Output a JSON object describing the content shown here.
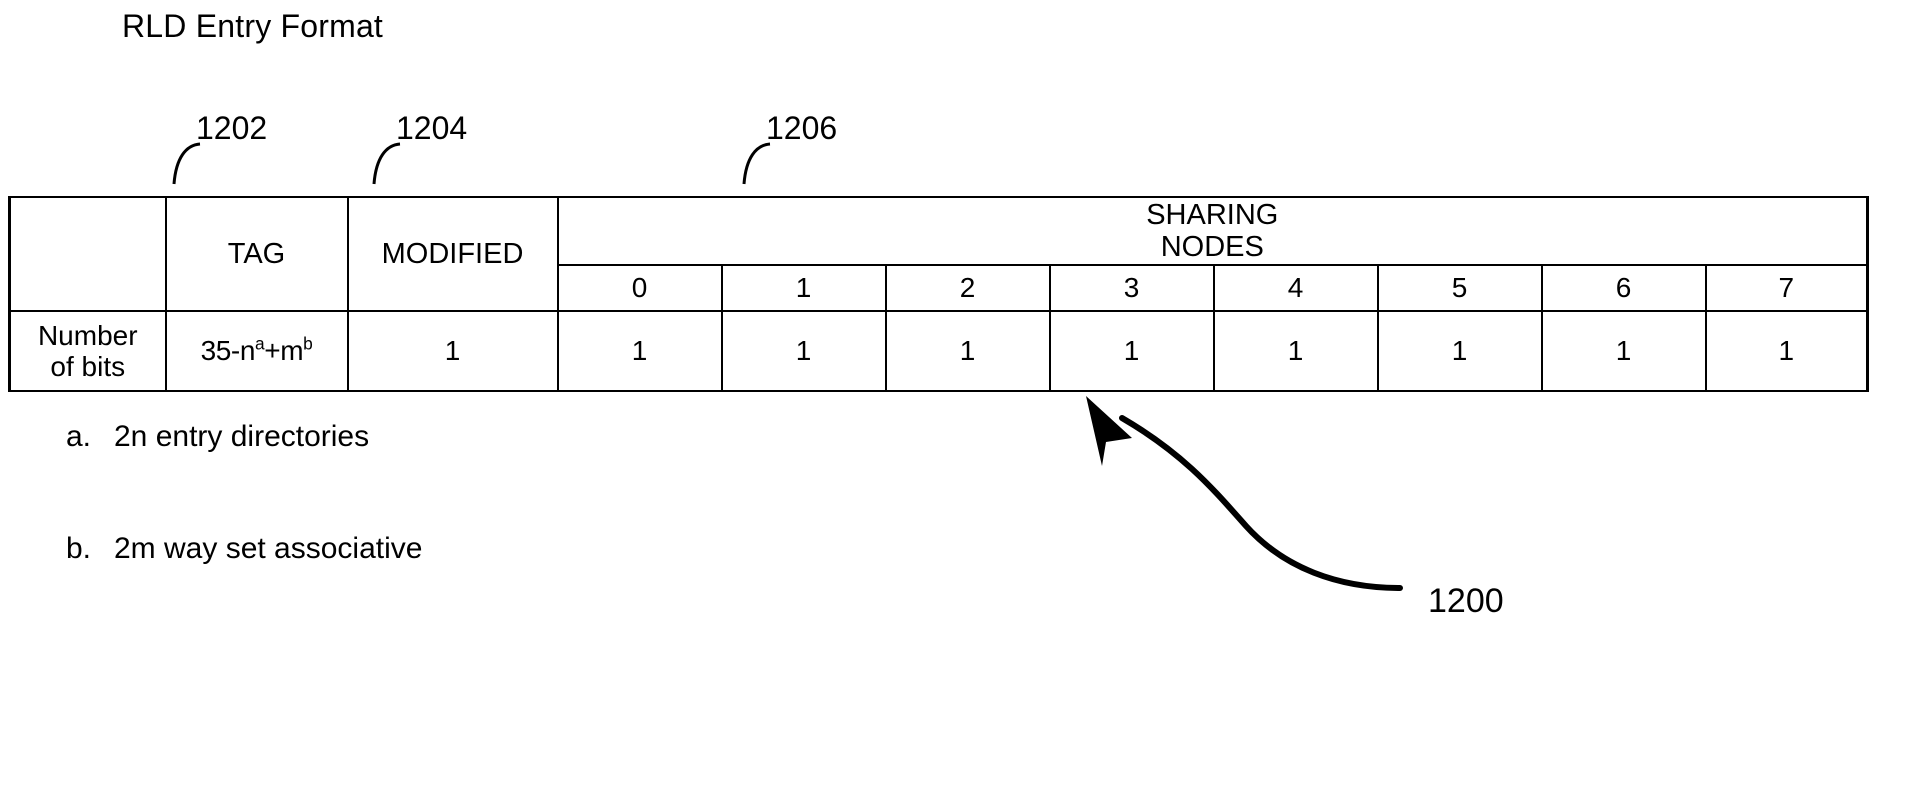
{
  "figure": {
    "title": "RLD Entry Format",
    "figure_ref": "1200"
  },
  "callouts": {
    "tag_ref": "1202",
    "modified_ref": "1204",
    "sharing_nodes_ref": "1206"
  },
  "table": {
    "row_label": {
      "line1": "Number",
      "line2": "of bits"
    },
    "headers": {
      "tag": "TAG",
      "modified": "MODIFIED",
      "sharing_nodes_line1": "SHARING",
      "sharing_nodes_line2": "NODES"
    },
    "node_indices": [
      "0",
      "1",
      "2",
      "3",
      "4",
      "5",
      "6",
      "7"
    ],
    "values": {
      "tag_bits": "35-n",
      "tag_bits_sup_a": "a",
      "tag_bits_mid": "+m",
      "tag_bits_sup_b": "b",
      "modified_bits": "1",
      "node_bits": [
        "1",
        "1",
        "1",
        "1",
        "1",
        "1",
        "1",
        "1"
      ]
    }
  },
  "footnotes": [
    {
      "marker": "a.",
      "text": "2n entry directories"
    },
    {
      "marker": "b.",
      "text": "2m way set associative"
    }
  ],
  "colors": {
    "ink": "#000000",
    "paper": "#ffffff"
  }
}
